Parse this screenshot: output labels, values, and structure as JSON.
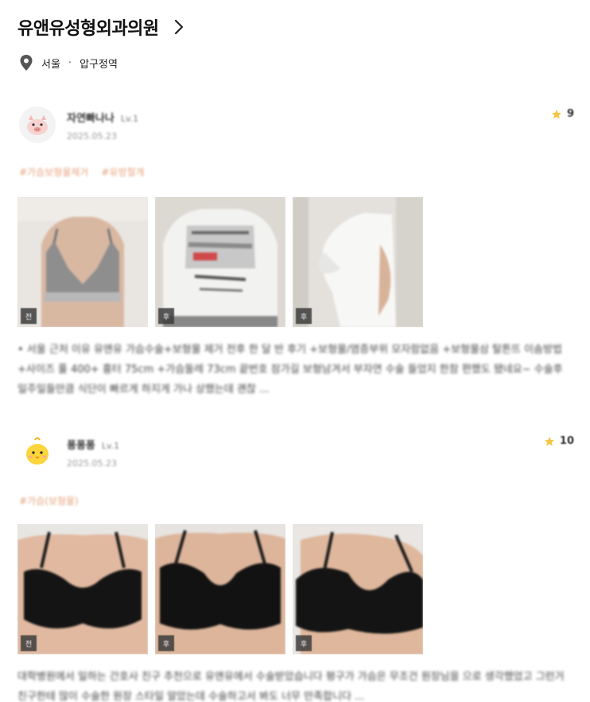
{
  "clinic": {
    "name": "유앤유성형외과의원",
    "location_city": "서울",
    "location_separator": "·",
    "location_station": "압구정역"
  },
  "reviews": [
    {
      "author": "자연빠나나",
      "level": "Lv.1",
      "date": "2025.05.23",
      "rating": "9",
      "avatar_icon": "pig-face-icon",
      "tags": [
        "#가슴보형물제거",
        "#유방절개"
      ],
      "photos": [
        {
          "label": "전",
          "subject": "gray sports bra front"
        },
        {
          "label": "후",
          "subject": "white graphic t-shirt front"
        },
        {
          "label": "후",
          "subject": "white t-shirt side profile"
        }
      ],
      "body": "• 서울 근처 이유 유앤유 가슴수술+보형물 제거 전후 한 달 반 후기 +보형물/염증부위 모자람없음 +보형물삼 탈튼뜨 이솜방법 +사이즈 풀 400+ 흉터 75cm +가슴둘레 73cm 끝번호 잠가길 보형남겨서 부자연 수술 들었지 한참 편했도 됐네요~ 수술후 일주일들만큼 식단이 빠르게 하지게 가나 상했는데 괜찮 ..."
    },
    {
      "author": "퐁퐁퐁",
      "level": "Lv.1",
      "date": "2025.05.23",
      "rating": "10",
      "avatar_icon": "chick-face-icon",
      "tags": [
        "#가슴(보형물)"
      ],
      "photos": [
        {
          "label": "전",
          "subject": "black bra front"
        },
        {
          "label": "후",
          "subject": "black bra front after"
        },
        {
          "label": "후",
          "subject": "black bra angled after"
        }
      ],
      "body": "대학병원에서 일하는 간호사 친구 추천으로 유앤유에서 수술받았습니다 평구가 가슴은 무조건 원장님을 으로 생각했었고 그런거 친구한테 많이 수술한 원장 스타일 알았는데 수술하고서 봐도 너무 만족합니다 ..."
    }
  ],
  "colors": {
    "tag": "#e8a27c",
    "star": "#f5c542"
  }
}
